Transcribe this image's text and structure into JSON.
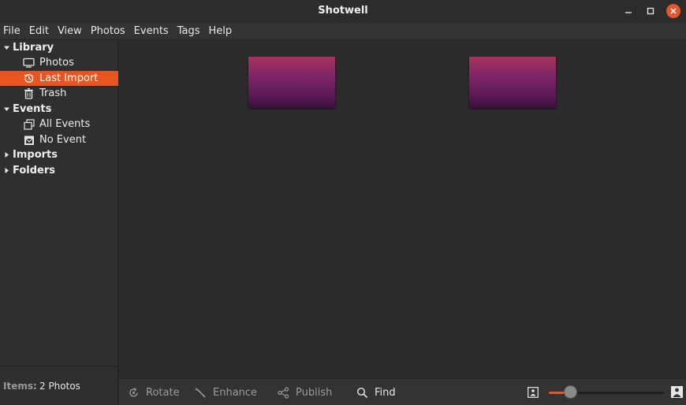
{
  "window": {
    "title": "Shotwell"
  },
  "menu": [
    "File",
    "Edit",
    "View",
    "Photos",
    "Events",
    "Tags",
    "Help"
  ],
  "sidebar": {
    "library": {
      "label": "Library",
      "items": [
        {
          "label": "Photos",
          "icon": "monitor-icon"
        },
        {
          "label": "Last Import",
          "icon": "history-icon",
          "selected": true
        },
        {
          "label": "Trash",
          "icon": "trash-icon"
        }
      ]
    },
    "events": {
      "label": "Events",
      "items": [
        {
          "label": "All Events",
          "icon": "all-events-icon"
        },
        {
          "label": "No Event",
          "icon": "no-event-icon"
        }
      ]
    },
    "imports": {
      "label": "Imports"
    },
    "folders": {
      "label": "Folders"
    }
  },
  "status": {
    "items_label": "Items:",
    "items_value": "2 Photos"
  },
  "toolbar": {
    "rotate": "Rotate",
    "enhance": "Enhance",
    "publish": "Publish",
    "find": "Find",
    "zoom_level": 0.19
  },
  "colors": {
    "accent": "#e95420",
    "background": "#2b2b2b"
  }
}
